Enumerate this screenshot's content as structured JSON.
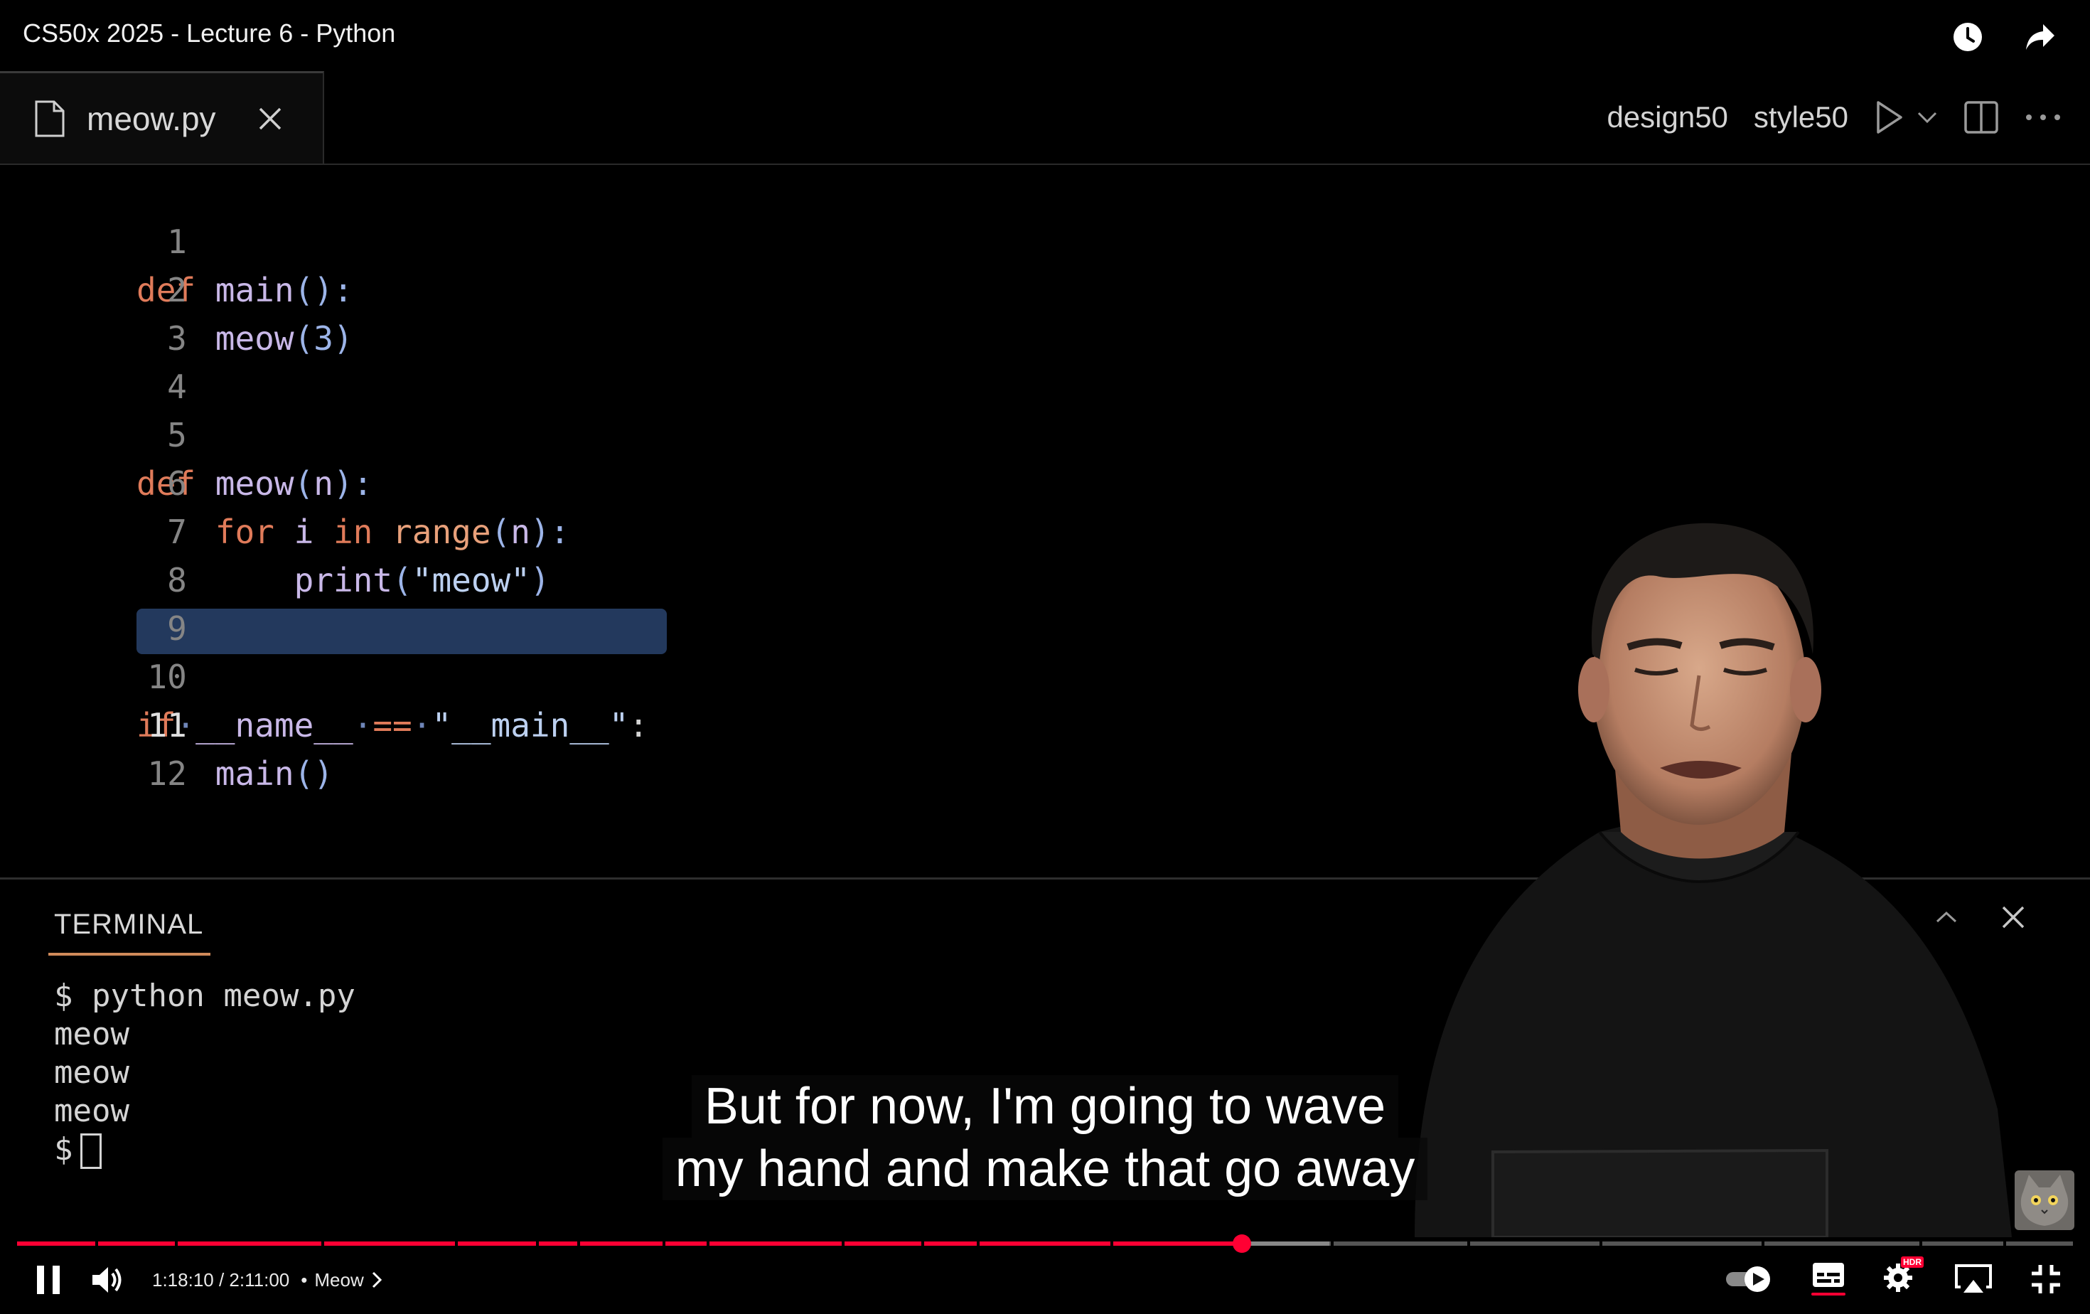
{
  "video": {
    "title": "CS50x 2025 - Lecture 6 - Python"
  },
  "top_icons": [
    "watch-later-icon",
    "share-icon"
  ],
  "editor": {
    "tab": {
      "filename": "meow.py"
    },
    "actions": {
      "design_label": "design50",
      "style_label": "style50"
    },
    "lines": [
      {
        "num": "1"
      },
      {
        "num": "2"
      },
      {
        "num": "3"
      },
      {
        "num": "4"
      },
      {
        "num": "5"
      },
      {
        "num": "6"
      },
      {
        "num": "7"
      },
      {
        "num": "8"
      },
      {
        "num": "9"
      },
      {
        "num": "10"
      },
      {
        "num": "11"
      },
      {
        "num": "12"
      }
    ],
    "code": {
      "l1_kw": "def",
      "l1_fn": "main",
      "l1_rest": "():",
      "l2_fn": "meow",
      "l2_open": "(",
      "l2_num": "3",
      "l2_close": ")",
      "l5_kw": "def",
      "l5_fn": "meow",
      "l5_open": "(",
      "l5_arg": "n",
      "l5_close": "):",
      "l6_kw1": "for",
      "l6_var": " i ",
      "l6_kw2": "in",
      "l6_fn": " range",
      "l6_open": "(",
      "l6_arg": "n",
      "l6_close": "):",
      "l7_fn": "print",
      "l7_open": "(",
      "l7_str": "\"meow\"",
      "l7_close": ")",
      "l10_kw": "if",
      "l10_dot1": "·",
      "l10_name": "__name__",
      "l10_dot2": "·",
      "l10_op": "==",
      "l10_dot3": "·",
      "l10_str": "\"__main__\"",
      "l10_colon": ":",
      "l11_fn": "main",
      "l11_rest": "()"
    },
    "current_line": "11"
  },
  "terminal": {
    "title": "TERMINAL",
    "lines": [
      "$ python meow.py",
      "meow",
      "meow",
      "meow"
    ],
    "prompt": "$"
  },
  "captions": {
    "line1": "But for now, I'm going to wave",
    "line2": "my hand and make that go away"
  },
  "player": {
    "time": "1:18:10 / 2:11:00",
    "chapter_separator": "•",
    "chapter": "Meow",
    "progress_fraction": 0.597,
    "accent_color": "#ff0033",
    "badge": "HDR"
  }
}
